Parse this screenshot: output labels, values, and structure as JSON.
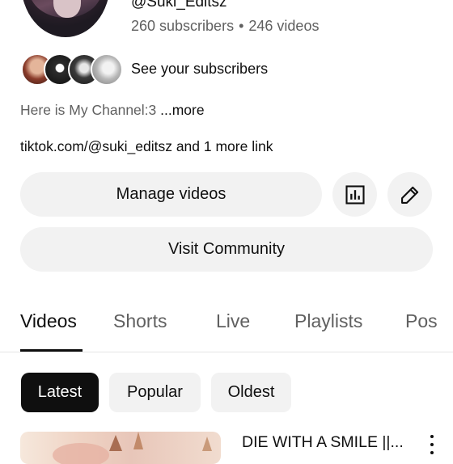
{
  "channel": {
    "handle": "@Suki_Editsz",
    "subscribers": "260 subscribers",
    "separator": "•",
    "videos": "246 videos",
    "avatar_icon": "channel-avatar-image"
  },
  "subscribers_preview": {
    "label": "See your subscribers",
    "avatars": [
      "subscriber-avatar-1",
      "subscriber-avatar-2",
      "subscriber-avatar-3",
      "subscriber-avatar-4"
    ]
  },
  "description": {
    "text": "Here is My Channel:3",
    "more": " ...more"
  },
  "links": {
    "text": "tiktok.com/@suki_editsz and 1 more link"
  },
  "actions": {
    "manage_videos": "Manage videos",
    "analytics_icon": "analytics-icon",
    "edit_icon": "pencil-icon",
    "visit_community": "Visit Community"
  },
  "tabs": [
    {
      "label": "Videos",
      "active": true
    },
    {
      "label": "Shorts",
      "active": false
    },
    {
      "label": "Live",
      "active": false
    },
    {
      "label": "Playlists",
      "active": false
    },
    {
      "label": "Pos",
      "active": false
    }
  ],
  "filter_chips": [
    {
      "label": "Latest",
      "selected": true
    },
    {
      "label": "Popular",
      "selected": false
    },
    {
      "label": "Oldest",
      "selected": false
    }
  ],
  "videos": [
    {
      "title": "DIE WITH A SMILE ||...",
      "menu_icon": "more-vert-icon"
    }
  ],
  "colors": {
    "text_primary": "#0f0f0f",
    "text_secondary": "#606060",
    "button_bg": "#f2f2f2",
    "selected_chip_bg": "#0f0f0f"
  }
}
